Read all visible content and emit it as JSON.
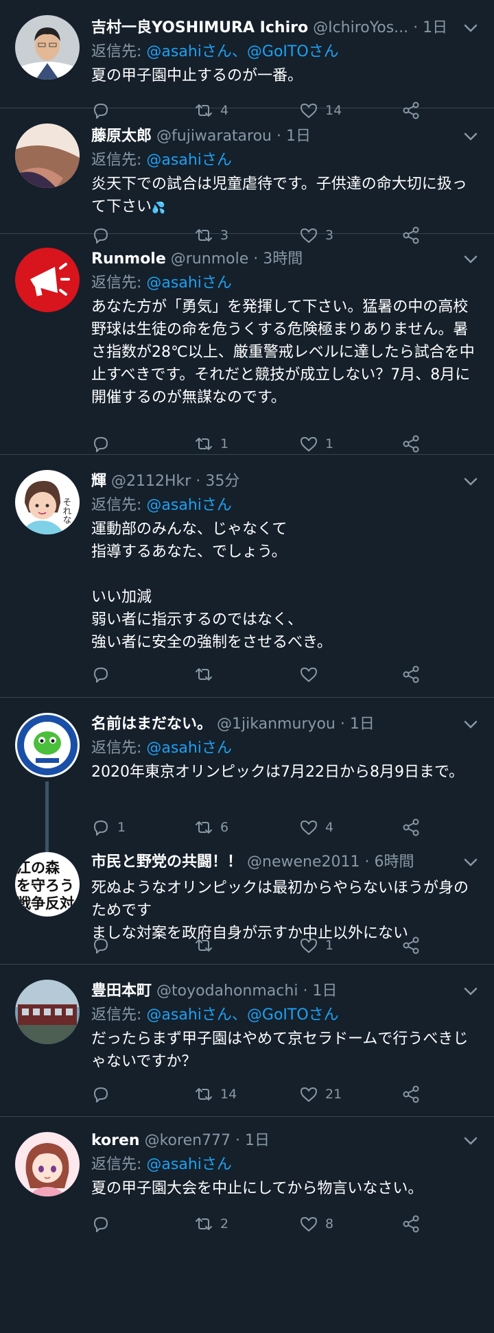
{
  "reply_prefix": "返信先:",
  "tweets": [
    {
      "name": "吉村一良YOSHIMURA Ichiro",
      "handle": "@IchiroYos...",
      "time": "1日",
      "reply_to": "@asahiさん、@GoITOさん",
      "body": "夏の甲子園中止するのが一番。",
      "replies": "",
      "retweets": "4",
      "likes": "14"
    },
    {
      "name": "藤原太郎",
      "handle": "@fujiwaratarou",
      "time": "1日",
      "reply_to": "@asahiさん",
      "body": "炎天下での試合は児童虐待です。子供達の命大切に扱って下さい",
      "body_suffix": "💦",
      "replies": "",
      "retweets": "3",
      "likes": "3"
    },
    {
      "name": "Runmole",
      "handle": "@runmole",
      "time": "3時間",
      "reply_to": "@asahiさん",
      "body": "あなた方が「勇気」を発揮して下さい。猛暑の中の高校野球は生徒の命を危うくする危険極まりありません。暑さ指数が28℃以上、厳重警戒レベルに達したら試合を中止すべきです。それだと競技が成立しない？7月、8月に開催するのが無謀なのです。",
      "replies": "",
      "retweets": "1",
      "likes": "1"
    },
    {
      "name": "輝",
      "handle": "@2112Hkr",
      "time": "35分",
      "reply_to": "@asahiさん",
      "body": "運動部のみんな、じゃなくて\n指導するあなた、でしょう。\n\nいい加減\n弱い者に指示するのではなく、\n強い者に安全の強制をさせるべき。",
      "replies": "",
      "retweets": "",
      "likes": ""
    },
    {
      "name": "名前はまだない。",
      "handle": "@1jikanmuryou",
      "time": "1日",
      "reply_to": "@asahiさん",
      "body": "2020年東京オリンピックは7月22日から8月9日まで。",
      "replies": "1",
      "retweets": "6",
      "likes": "4"
    },
    {
      "name": "市民と野党の共闘！！",
      "handle": "@newene2011",
      "time": "6時間",
      "reply_to": "",
      "body": "死ぬようなオリンピックは最初からやらないほうが身のためです\nましな対案を政府自身が示すか中止以外にない",
      "replies": "",
      "retweets": "",
      "likes": "1"
    },
    {
      "name": "豊田本町",
      "handle": "@toyodahonmachi",
      "time": "1日",
      "reply_to": "@asahiさん、@GoITOさん",
      "body": "だったらまず甲子園はやめて京セラドームで行うべきじゃないですか？",
      "replies": "",
      "retweets": "14",
      "likes": "21"
    },
    {
      "name": "koren",
      "handle": "@koren777",
      "time": "1日",
      "reply_to": "@asahiさん",
      "body": "夏の甲子園大会を中止にしてから物言いなさい。",
      "replies": "",
      "retweets": "2",
      "likes": "8"
    }
  ],
  "avatar_texts": {
    "hikaru": "それな",
    "shimin_line1": "江の森",
    "shimin_line2": "を守ろう",
    "shimin_line3": "戦争反対"
  },
  "icons": {
    "reply": "reply-icon",
    "retweet": "retweet-icon",
    "like": "heart-icon",
    "share": "share-icon",
    "menu": "chevron-down-icon"
  },
  "colors": {
    "background": "#15202b",
    "divider": "#38444d",
    "secondary_text": "#8899a6",
    "accent": "#1da1f2"
  }
}
